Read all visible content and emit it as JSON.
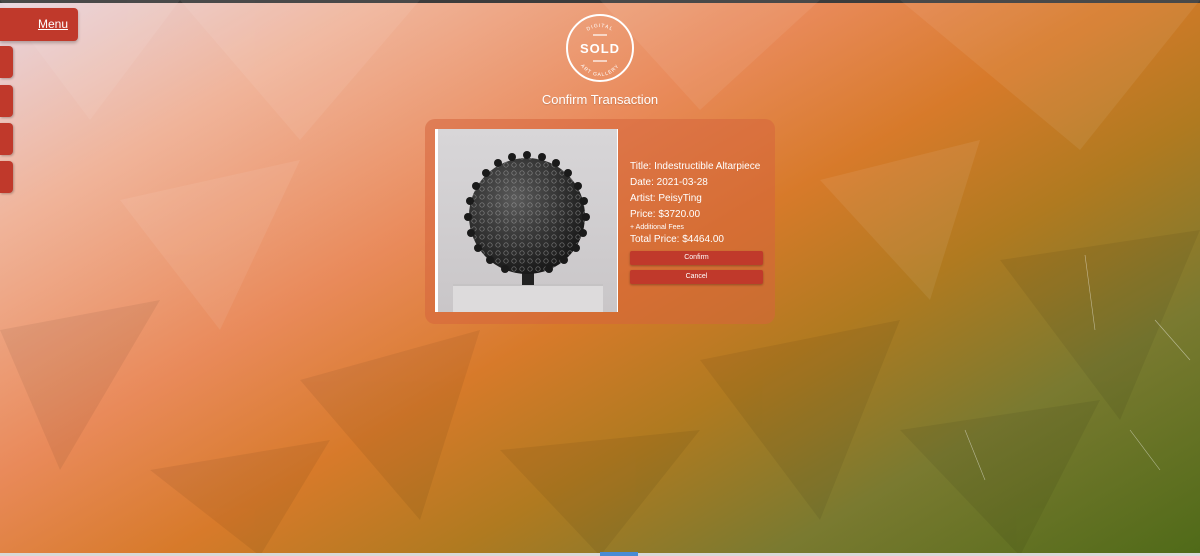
{
  "nav": {
    "menu_label": "Menu"
  },
  "logo": {
    "top_text": "DIGITAL",
    "main_text": "SOLD",
    "bottom_text": "ART GALLERY"
  },
  "page": {
    "title": "Confirm Transaction"
  },
  "artwork": {
    "title_line": "Title: Indestructible Altarpiece",
    "date_line": "Date: 2021-03-28",
    "artist_line": "Artist: PeisyTing",
    "price_line": "Price: $3720.00",
    "fees_line": "+ Additional Fees",
    "total_line": "Total Price: $4464.00"
  },
  "actions": {
    "confirm_label": "Confirm",
    "cancel_label": "Cancel"
  },
  "colors": {
    "accent": "#c0392b"
  }
}
